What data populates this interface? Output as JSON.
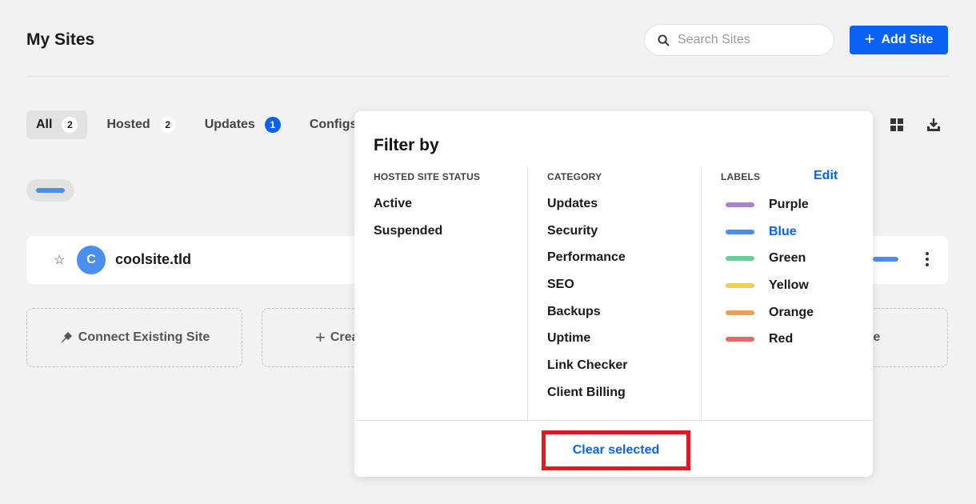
{
  "header": {
    "title": "My Sites",
    "search_placeholder": "Search Sites",
    "add_site_label": "Add Site"
  },
  "tabs": [
    {
      "label": "All",
      "count": "2",
      "active": true
    },
    {
      "label": "Hosted",
      "count": "2"
    },
    {
      "label": "Updates",
      "count": "1",
      "highlight": true
    },
    {
      "label": "Configs"
    }
  ],
  "site": {
    "avatar_letter": "C",
    "name": "coolsite.tld"
  },
  "actions": {
    "connect_label": "Connect Existing Site",
    "create_label": "Crea",
    "third_label": "te"
  },
  "filter": {
    "title": "Filter by",
    "hosted": {
      "heading": "HOSTED SITE STATUS",
      "options": [
        "Active",
        "Suspended"
      ]
    },
    "category": {
      "heading": "CATEGORY",
      "options": [
        "Updates",
        "Security",
        "Performance",
        "SEO",
        "Backups",
        "Uptime",
        "Link Checker",
        "Client Billing"
      ]
    },
    "labels": {
      "heading": "LABELS",
      "edit_label": "Edit",
      "items": [
        {
          "name": "Purple",
          "color": "#b07fd3"
        },
        {
          "name": "Blue",
          "color": "#4a8ff0",
          "selected": true
        },
        {
          "name": "Green",
          "color": "#6ccb96"
        },
        {
          "name": "Yellow",
          "color": "#f0cc5e"
        },
        {
          "name": "Orange",
          "color": "#ec9f5a"
        },
        {
          "name": "Red",
          "color": "#e86b66"
        }
      ]
    },
    "clear_label": "Clear selected"
  },
  "colors": {
    "accent": "#0a62f5",
    "highlight_border": "#e8141e",
    "label_blue": "#4a8ff0"
  }
}
